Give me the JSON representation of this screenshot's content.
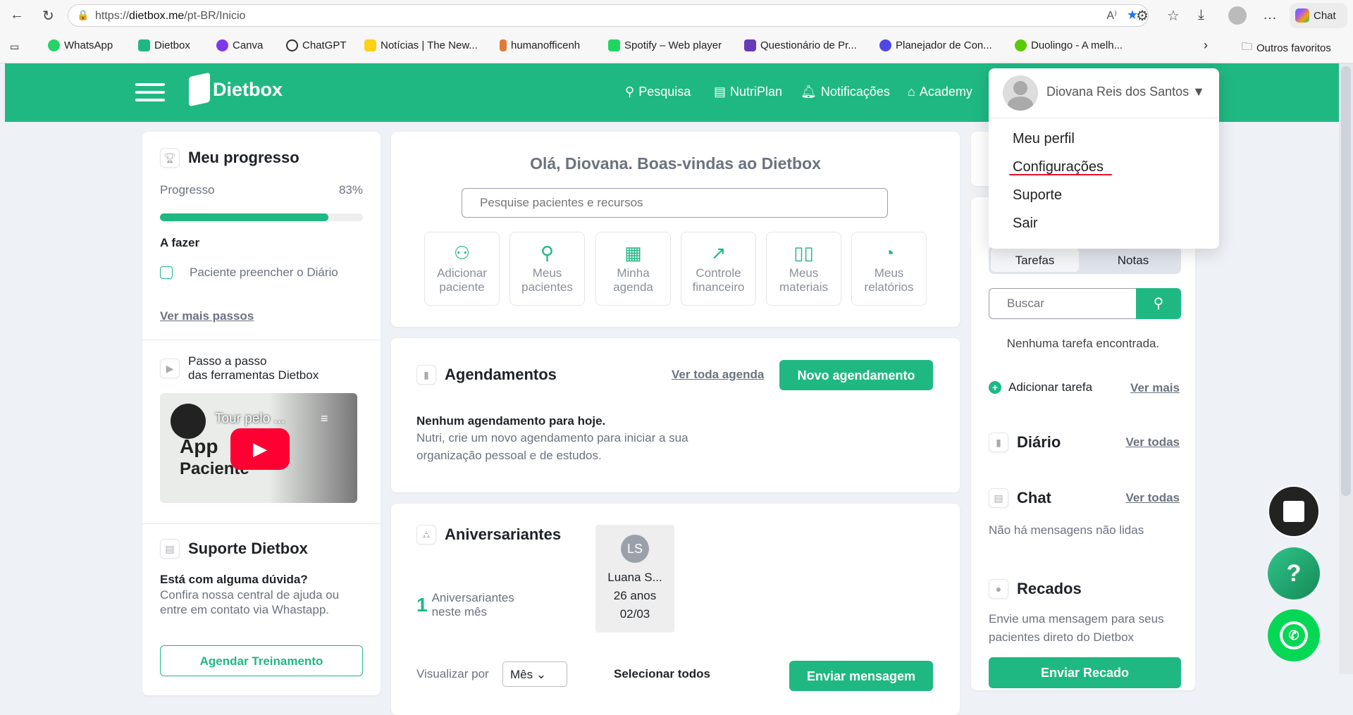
{
  "browser": {
    "url_prefix": "https://",
    "url_host": "dietbox.me",
    "url_path": "/pt-BR/Inicio",
    "chat_label": "Chat",
    "bookmarks": [
      "WhatsApp",
      "Dietbox",
      "Canva",
      "ChatGPT",
      "Notícias | The New...",
      "humanofficenh",
      "Spotify – Web player",
      "Questionário de Pr...",
      "Planejador de Con...",
      "Duolingo - A melh..."
    ],
    "other_favorites": "Outros favoritos"
  },
  "header": {
    "logo": "Dietbox",
    "nav": [
      "Pesquisa",
      "NutriPlan",
      "Notificações",
      "Academy"
    ]
  },
  "user_menu": {
    "name": "Diovana Reis dos Santos",
    "items": [
      "Meu perfil",
      "Configurações",
      "Suporte",
      "Sair"
    ]
  },
  "progress_card": {
    "title": "Meu progresso",
    "label": "Progresso",
    "value": "83%",
    "percent": 83,
    "todo_title": "A fazer",
    "todo_items": [
      "Paciente preencher o Diário"
    ],
    "more_link": "Ver mais passos"
  },
  "tutorial": {
    "line1": "Passo a passo",
    "line2": "das ferramentas Dietbox",
    "video_title": "Tour pelo ...",
    "thumb_line1": "App",
    "thumb_line2": "Paciente"
  },
  "support": {
    "title": "Suporte Dietbox",
    "question": "Está com alguma dúvida?",
    "text": "Confira nossa central de ajuda ou entre em contato via Whastapp.",
    "button": "Agendar Treinamento"
  },
  "welcome": {
    "title": "Olá, Diovana. Boas-vindas ao Dietbox",
    "search_placeholder": "Pesquise pacientes e recursos",
    "tiles": [
      {
        "l1": "Adicionar",
        "l2": "paciente"
      },
      {
        "l1": "Meus",
        "l2": "pacientes"
      },
      {
        "l1": "Minha",
        "l2": "agenda"
      },
      {
        "l1": "Controle",
        "l2": "financeiro"
      },
      {
        "l1": "Meus",
        "l2": "materiais"
      },
      {
        "l1": "Meus",
        "l2": "relatórios"
      }
    ]
  },
  "appointments": {
    "title": "Agendamentos",
    "link": "Ver toda agenda",
    "button": "Novo agendamento",
    "empty_title": "Nenhum agendamento para hoje.",
    "empty_text1": "Nutri, crie um novo agendamento para iniciar a sua",
    "empty_text2": "organização pessoal e de estudos."
  },
  "birthdays": {
    "title": "Aniversariantes",
    "count": "1",
    "count_l1": "Aniversariantes",
    "count_l2": "neste mês",
    "person": {
      "initials": "LS",
      "name": "Luana S...",
      "age": "26 anos",
      "date": "02/03"
    },
    "view_by": "Visualizar por",
    "view_value": "Mês",
    "select_all": "Selecionar todos",
    "send_button": "Enviar mensagem"
  },
  "tasks": {
    "tabs": [
      "Tarefas",
      "Notas"
    ],
    "search_placeholder": "Buscar",
    "empty": "Nenhuma tarefa encontrada.",
    "add": "Adicionar tarefa",
    "more": "Ver mais"
  },
  "diary": {
    "title": "Diário",
    "link": "Ver todas"
  },
  "chat": {
    "title": "Chat",
    "link": "Ver todas",
    "empty": "Não há mensagens não lidas"
  },
  "notes": {
    "title": "Recados",
    "text1": "Envie uma mensagem para seus",
    "text2": "pacientes direto do Dietbox",
    "button": "Enviar Recado"
  },
  "fab": {
    "help": "?"
  }
}
